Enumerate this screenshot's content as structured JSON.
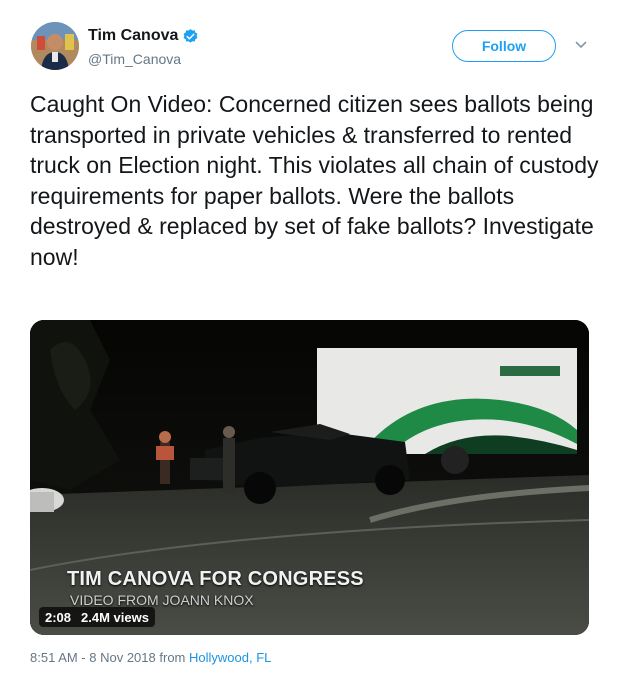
{
  "author": {
    "name": "Tim Canova",
    "handle": "@Tim_Canova",
    "verified": true,
    "verified_icon": "verified-badge-icon",
    "verified_color": "#1da1f2"
  },
  "actions": {
    "follow_label": "Follow",
    "menu_icon": "chevron-down-icon",
    "accent": "#1da1f2"
  },
  "tweet": {
    "text": "Caught On Video: Concerned citizen sees ballots being transported in private vehicles & transferred to rented truck on Election night. This violates all chain of custody requirements for paper ballots. Were the ballots destroyed & replaced by set of fake ballots? Investigate now!"
  },
  "video": {
    "caption_line1": "TIM CANOVA FOR CONGRESS",
    "caption_line2": "VIDEO FROM JOANN KNOX",
    "duration": "2:08",
    "views": "2.4M views"
  },
  "meta": {
    "timestamp": "8:51 AM - 8 Nov 2018",
    "from_label": "from",
    "place": "Hollywood, FL"
  }
}
